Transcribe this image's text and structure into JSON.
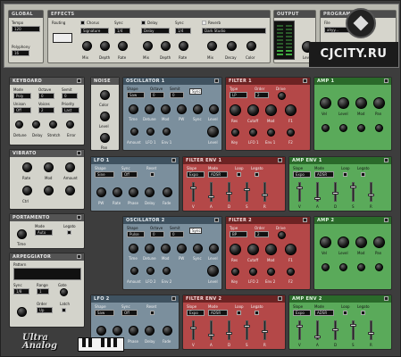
{
  "top": {
    "global": {
      "title": "GLOBAL",
      "tempo_label": "Tempo",
      "tempo_value": "120",
      "polyphony_label": "Polyphony",
      "polyphony_value": "16"
    },
    "effects": {
      "title": "EFFECTS",
      "routing_label": "Routing",
      "chorus": {
        "label": "Chorus",
        "type": "Signature",
        "sync_label": "Sync",
        "sync_value": "1/4",
        "knobs": [
          "Mix",
          "Depth",
          "Rate"
        ]
      },
      "delay": {
        "label": "Delay",
        "type": "Delay",
        "sync_label": "Sync",
        "sync_value": "1/4",
        "knobs": [
          "Mix",
          "Depth",
          "Rate"
        ]
      },
      "reverb": {
        "label": "Reverb",
        "type": "Dark Studio",
        "knobs": [
          "Mix",
          "Decay",
          "Color"
        ]
      }
    },
    "output": {
      "title": "OUTPUT",
      "level_label": "Level"
    },
    "program": {
      "title": "PROGRAM",
      "file_label": "File",
      "file_value": "ahyy..."
    }
  },
  "left": {
    "keyboard": {
      "title": "KEYBOARD",
      "mode_label": "Mode",
      "mode_value": "Poly",
      "octave_label": "Octave",
      "octave_value": "0",
      "semit_label": "Semit",
      "semit_value": "0",
      "unison_label": "Unison",
      "unison_value": "Off",
      "voices_label": "Voices",
      "voices_value": "2",
      "priority_label": "Priority",
      "priority_value": "Last",
      "knobs": [
        "Detune",
        "Delay",
        "Stretch",
        "Error"
      ]
    },
    "vibrato": {
      "title": "VIBRATO",
      "knobs": [
        "Rate",
        "Mod",
        "Amount",
        "Ctrl"
      ]
    },
    "portamento": {
      "title": "PORTAMENTO",
      "mode_label": "Mode",
      "mode_value": "Auto",
      "legato_label": "Legato",
      "time_label": "Time"
    },
    "arpeggiator": {
      "title": "ARPEGGIATOR",
      "pattern_label": "Pattern",
      "sync_label": "Sync",
      "sync_value": "1/8",
      "range_label": "Range",
      "range_value": "1",
      "order_label": "Order",
      "order_value": "Up",
      "latch_label": "Latch",
      "gate_label": "Gate"
    }
  },
  "layers": [
    {
      "noise": {
        "title": "NOISE",
        "knobs": [
          "Color",
          "Level",
          "Pan"
        ]
      },
      "oscillator": {
        "title": "OSCILLATOR 1",
        "shape_label": "Shape",
        "shape_value": "Saw",
        "octave_label": "Octave",
        "octave_value": "0",
        "semit_label": "Semit",
        "semit_value": "0",
        "sync_label": "Sync",
        "knobs": [
          "Time",
          "Detune",
          "Mod",
          "PW",
          "Sync",
          "Level"
        ],
        "sub": [
          "Amount",
          "LFO 1",
          "Env 1",
          "Level"
        ]
      },
      "filter": {
        "title": "FILTER 1",
        "type_label": "Type",
        "type_value": "LP",
        "order_label": "Order",
        "order_value": "2",
        "drive_label": "Drive",
        "knobs": [
          "Res",
          "Cutoff",
          "Mod",
          "F1"
        ],
        "sub": [
          "Key",
          "LFO 1",
          "Env 1",
          "F2"
        ]
      },
      "amp": {
        "title": "AMP 1",
        "knobs": [
          "Vel",
          "Level",
          "Mod",
          "Pan"
        ]
      },
      "lfo": {
        "title": "LFO 1",
        "shape_label": "Shape",
        "shape_value": "Sine",
        "sync_label": "Sync",
        "sync_value": "Off",
        "reset_label": "Reset",
        "knobs": [
          "PW",
          "Rate",
          "Phase",
          "Delay",
          "Fade"
        ]
      },
      "fenv": {
        "title": "FILTER ENV 1",
        "slope_label": "Slope",
        "slope_value": "Expo",
        "mode_label": "Mode",
        "mode_value": "ADSR",
        "loop_label": "Loop",
        "legato_label": "Legato",
        "sliders": [
          "V",
          "A",
          "D",
          "S",
          "R"
        ]
      },
      "aenv": {
        "title": "AMP ENV 1",
        "slope_label": "Slope",
        "slope_value": "Expo",
        "mode_label": "Mode",
        "mode_value": "ADSR",
        "loop_label": "Loop",
        "legato_label": "Legato",
        "sliders": [
          "V",
          "A",
          "D",
          "S",
          "R"
        ]
      }
    },
    {
      "oscillator": {
        "title": "OSCILLATOR 2",
        "shape_label": "Shape",
        "shape_value": "Pulse",
        "octave_label": "Octave",
        "octave_value": "0",
        "semit_label": "Semit",
        "semit_value": "0",
        "sync_label": "Sync",
        "knobs": [
          "Time",
          "Detune",
          "Mod",
          "PW",
          "Sync",
          "Level"
        ],
        "sub": [
          "Amount",
          "LFO 2",
          "Env 2",
          "Level"
        ]
      },
      "filter": {
        "title": "FILTER 2",
        "type_label": "Type",
        "type_value": "BP",
        "order_label": "Order",
        "order_value": "2",
        "drive_label": "Drive",
        "knobs": [
          "Res",
          "Cutoff",
          "Mod",
          "F1"
        ],
        "sub": [
          "Key",
          "LFO 2",
          "Env 2",
          "F2"
        ]
      },
      "amp": {
        "title": "AMP 2",
        "knobs": [
          "Vel",
          "Level",
          "Mod",
          "Pan"
        ]
      },
      "lfo": {
        "title": "LFO 2",
        "shape_label": "Shape",
        "shape_value": "Saw",
        "sync_label": "Sync",
        "sync_value": "Off",
        "reset_label": "Reset",
        "knobs": [
          "PW",
          "Rate",
          "Phase",
          "Delay",
          "Fade"
        ]
      },
      "fenv": {
        "title": "FILTER ENV 2",
        "slope_label": "Slope",
        "slope_value": "Expo",
        "mode_label": "Mode",
        "mode_value": "ADSR",
        "loop_label": "Loop",
        "legato_label": "Legato",
        "sliders": [
          "V",
          "A",
          "D",
          "S",
          "R"
        ]
      },
      "aenv": {
        "title": "AMP ENV 2",
        "slope_label": "Slope",
        "slope_value": "Expo",
        "mode_label": "Mode",
        "mode_value": "ADSR",
        "loop_label": "Loop",
        "legato_label": "Legato",
        "sliders": [
          "V",
          "A",
          "D",
          "S",
          "R"
        ]
      }
    }
  ],
  "brand": {
    "line1": "Ultra",
    "line2": "Analog"
  },
  "watermark": {
    "text": "CJCITY.RU"
  }
}
